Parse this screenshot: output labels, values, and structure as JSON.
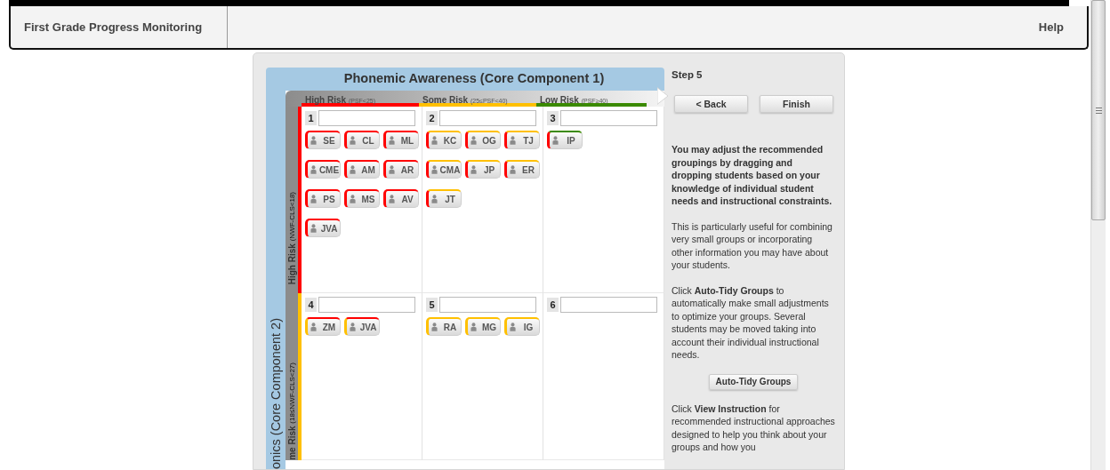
{
  "nav": {
    "title": "First Grade Progress Monitoring",
    "help": "Help"
  },
  "grid": {
    "title": "Phonemic Awareness (Core Component 1)",
    "side_title": "onics (Core Component 2)",
    "columns": [
      {
        "label": "High Risk",
        "range": "(PSF<25)",
        "color": "#ff0000"
      },
      {
        "label": "Some Risk",
        "range": "(25≤PSF<40)",
        "color": "#ffc000"
      },
      {
        "label": "Low Risk",
        "range": "(PSF≥40)",
        "color": "#3a8a00"
      }
    ],
    "rows": [
      {
        "label": "High Risk",
        "range": "(NWF-CLS<18)",
        "color": "#ff0000",
        "groups": [
          {
            "number": "1",
            "students": [
              {
                "initials": "SE",
                "color": "#ff0000"
              },
              {
                "initials": "CL",
                "color": "#ff0000"
              },
              {
                "initials": "ML",
                "color": "#ff0000"
              },
              {
                "initials": "CME",
                "color": "#ff0000"
              },
              {
                "initials": "AM",
                "color": "#ff0000"
              },
              {
                "initials": "AR",
                "color": "#ff0000"
              },
              {
                "initials": "PS",
                "color": "#ff0000"
              },
              {
                "initials": "MS",
                "color": "#ff0000"
              },
              {
                "initials": "AV",
                "color": "#ff0000"
              },
              {
                "initials": "JVA",
                "color": "#ff0000"
              }
            ]
          },
          {
            "number": "2",
            "students": [
              {
                "initials": "KC",
                "color": "#ffc000"
              },
              {
                "initials": "OG",
                "color": "#ffc000"
              },
              {
                "initials": "TJ",
                "color": "#ffc000"
              },
              {
                "initials": "CMA",
                "color": "#ffc000"
              },
              {
                "initials": "JP",
                "color": "#ffc000"
              },
              {
                "initials": "ER",
                "color": "#ffc000"
              },
              {
                "initials": "JT",
                "color": "#ffc000"
              }
            ]
          },
          {
            "number": "3",
            "students": [
              {
                "initials": "IP",
                "color": "#3a8a00"
              }
            ]
          }
        ]
      },
      {
        "label": "me Risk",
        "range": "(18≤NWF-CLS<27)",
        "color": "#ffc000",
        "groups": [
          {
            "number": "4",
            "students": [
              {
                "initials": "ZM",
                "color": "#ff0000"
              },
              {
                "initials": "JVA",
                "color": "#ff0000"
              }
            ]
          },
          {
            "number": "5",
            "students": [
              {
                "initials": "RA",
                "color": "#ffc000"
              },
              {
                "initials": "MG",
                "color": "#ffc000"
              },
              {
                "initials": "IG",
                "color": "#ffc000"
              }
            ]
          },
          {
            "number": "6"
          }
        ]
      }
    ]
  },
  "panel": {
    "step": "Step 5",
    "back": "< Back",
    "finish": "Finish",
    "notes": [
      {
        "text": "You may adjust the recommended groupings by dragging and dropping students based on your knowledge of individual student needs and instructional constraints.",
        "bold": true
      },
      {
        "text": "This is particularly useful for combining very small groups or incorporating other information you may have about your students.",
        "bold": false
      },
      {
        "text": "Click **Auto-Tidy Groups** to automatically make small adjustments to optimize your groups. Several students may be moved taking into account their individual instructional needs.",
        "bold": false
      }
    ],
    "tidy_button": "Auto-Tidy Groups",
    "notes_after": [
      {
        "text": "Click **View Instruction** for recommended instructional approaches designed to help you think about your groups and how you",
        "bold": false
      }
    ]
  }
}
